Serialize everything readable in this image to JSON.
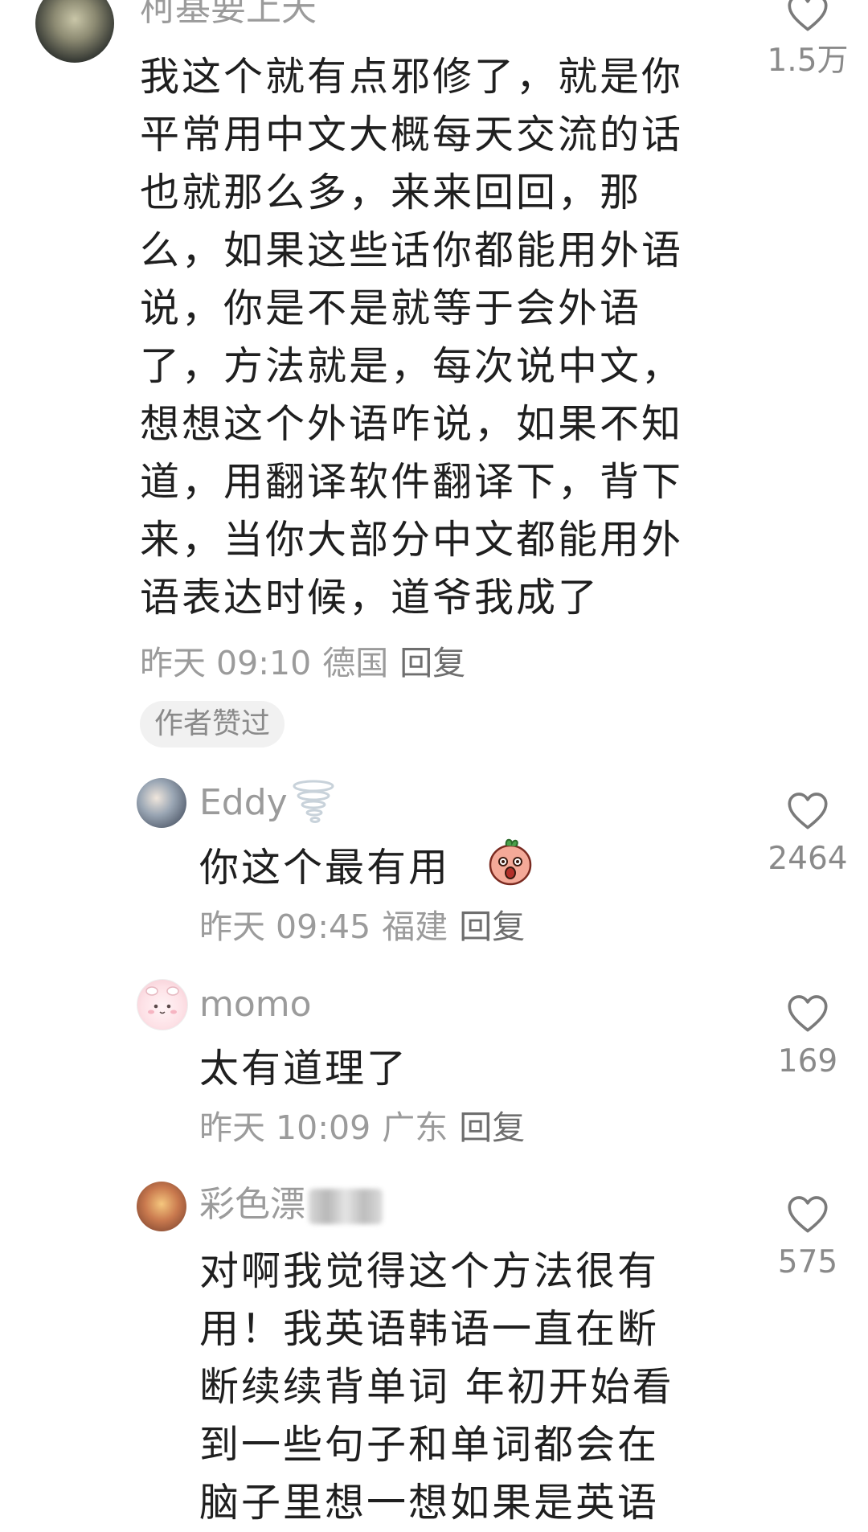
{
  "comments": [
    {
      "username": "柯基要上天",
      "lines": [
        "我这个就有点邪修了，就是你",
        "平常用中文大概每天交流的话",
        "也就那么多，来来回回，那",
        "么，如果这些话你都能用外语",
        "说，你是不是就等于会外语",
        "了，方法就是，每次说中文，",
        "想想这个外语咋说，如果不知",
        "道，用翻译软件翻译下，背下",
        "来，当你大部分中文都能用外",
        "语表达时候，道爷我成了"
      ],
      "time": "昨天 09:10",
      "location": "德国",
      "reply_label": "回复",
      "badge": "作者赞过",
      "likes": "1.5万"
    },
    {
      "username": "Eddy",
      "lines": [
        "你这个最有用"
      ],
      "time": "昨天 09:45",
      "location": "福建",
      "reply_label": "回复",
      "likes": "2464"
    },
    {
      "username": "momo",
      "lines": [
        "太有道理了"
      ],
      "time": "昨天 10:09",
      "location": "广东",
      "reply_label": "回复",
      "likes": "169"
    },
    {
      "username": "彩色漂",
      "lines": [
        "对啊我觉得这个方法很有",
        "用！我英语韩语一直在断",
        "断续续背单词 年初开始看",
        "到一些句子和单词都会在",
        "脑子里想一想如果是英语"
      ],
      "likes": "575"
    }
  ],
  "icons": {
    "like": "heart-outline-icon",
    "emoji": "surprised-face-emoji",
    "username_badge": "tornado-icon"
  }
}
